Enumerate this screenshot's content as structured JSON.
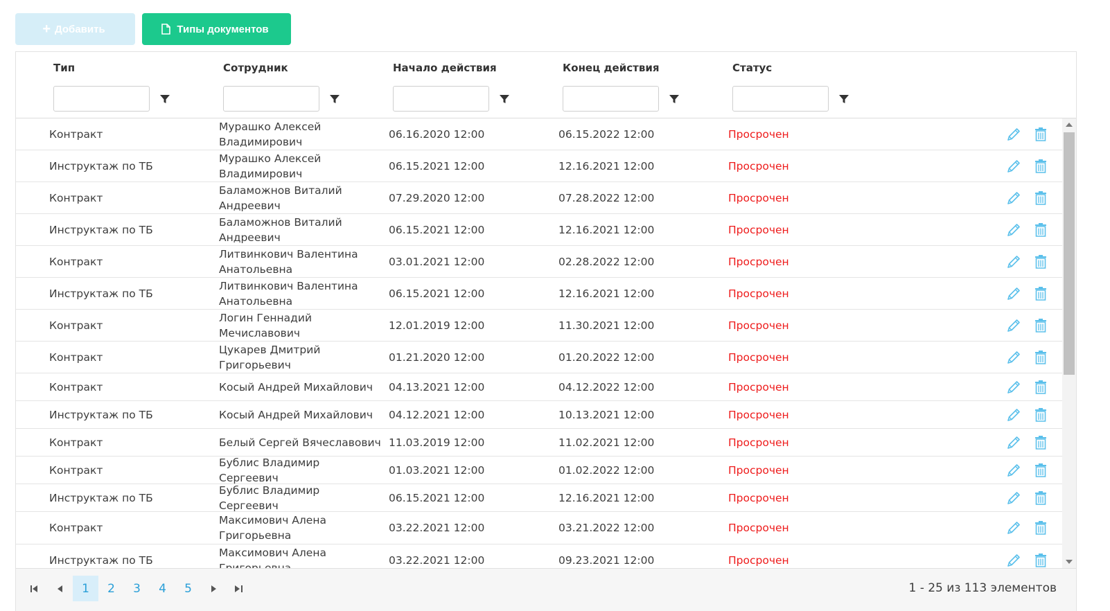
{
  "toolbar": {
    "add_label": "Добавить",
    "types_label": "Типы документов"
  },
  "columns": [
    "Тип",
    "Сотрудник",
    "Начало действия",
    "Конец действия",
    "Статус"
  ],
  "rows": [
    {
      "type": "Контракт",
      "employee": "Мурашко Алексей Владимирович",
      "start": "06.16.2020 12:00",
      "end": "06.15.2022 12:00",
      "status": "Просрочен"
    },
    {
      "type": "Инструктаж по ТБ",
      "employee": "Мурашко Алексей Владимирович",
      "start": "06.15.2021 12:00",
      "end": "12.16.2021 12:00",
      "status": "Просрочен"
    },
    {
      "type": "Контракт",
      "employee": "Баламожнов Виталий Андреевич",
      "start": "07.29.2020 12:00",
      "end": "07.28.2022 12:00",
      "status": "Просрочен"
    },
    {
      "type": "Инструктаж по ТБ",
      "employee": "Баламожнов Виталий Андреевич",
      "start": "06.15.2021 12:00",
      "end": "12.16.2021 12:00",
      "status": "Просрочен"
    },
    {
      "type": "Контракт",
      "employee": "Литвинкович Валентина Анатольевна",
      "start": "03.01.2021 12:00",
      "end": "02.28.2022 12:00",
      "status": "Просрочен"
    },
    {
      "type": "Инструктаж по ТБ",
      "employee": "Литвинкович Валентина Анатольевна",
      "start": "06.15.2021 12:00",
      "end": "12.16.2021 12:00",
      "status": "Просрочен"
    },
    {
      "type": "Контракт",
      "employee": "Логин Геннадий Мечиславович",
      "start": "12.01.2019 12:00",
      "end": "11.30.2021 12:00",
      "status": "Просрочен"
    },
    {
      "type": "Контракт",
      "employee": "Цукарев Дмитрий Григорьевич",
      "start": "01.21.2020 12:00",
      "end": "01.20.2022 12:00",
      "status": "Просрочен"
    },
    {
      "type": "Контракт",
      "employee": "Косый Андрей Михайлович",
      "start": "04.13.2021 12:00",
      "end": "04.12.2022 12:00",
      "status": "Просрочен"
    },
    {
      "type": "Инструктаж по ТБ",
      "employee": "Косый Андрей Михайлович",
      "start": "04.12.2021 12:00",
      "end": "10.13.2021 12:00",
      "status": "Просрочен"
    },
    {
      "type": "Контракт",
      "employee": "Белый Сергей Вячеславович",
      "start": "11.03.2019 12:00",
      "end": "11.02.2021 12:00",
      "status": "Просрочен"
    },
    {
      "type": "Контракт",
      "employee": "Бублис Владимир Сергеевич",
      "start": "01.03.2021 12:00",
      "end": "01.02.2022 12:00",
      "status": "Просрочен"
    },
    {
      "type": "Инструктаж по ТБ",
      "employee": "Бублис Владимир Сергеевич",
      "start": "06.15.2021 12:00",
      "end": "12.16.2021 12:00",
      "status": "Просрочен"
    },
    {
      "type": "Контракт",
      "employee": "Максимович Алена Григорьевна",
      "start": "03.22.2021 12:00",
      "end": "03.21.2022 12:00",
      "status": "Просрочен"
    },
    {
      "type": "Инструктаж по ТБ",
      "employee": "Максимович Алена Григорьевна",
      "start": "03.22.2021 12:00",
      "end": "09.23.2021 12:00",
      "status": "Просрочен"
    }
  ],
  "pager": {
    "pages": [
      "1",
      "2",
      "3",
      "4",
      "5"
    ],
    "active_page": "1",
    "info": "1 - 25 из 113 элементов"
  },
  "colors": {
    "add_button": "#d6eef8",
    "types_button": "#1cc98d",
    "status_overdue": "#ee1b1b",
    "action_icon": "#5bc0eb"
  }
}
